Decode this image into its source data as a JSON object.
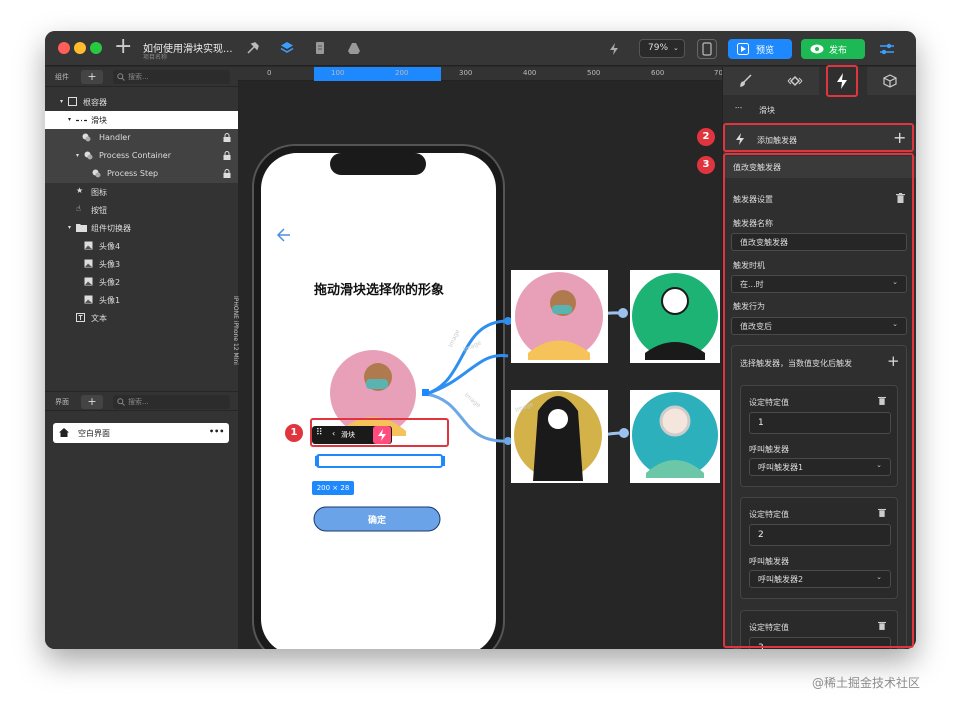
{
  "title": {
    "doc_title": "如何使用滑块实现...",
    "project": "项目名称",
    "zoom": "79%",
    "preview": "预览",
    "publish": "发布"
  },
  "layers": {
    "header": "组件",
    "search_placeholder": "搜索...",
    "items": [
      {
        "label": "根容器",
        "type": "container"
      },
      {
        "label": "滑块",
        "type": "slider",
        "selected": true
      },
      {
        "label": "Handler",
        "type": "group",
        "locked": true
      },
      {
        "label": "Process Container",
        "type": "group",
        "locked": true
      },
      {
        "label": "Process Step",
        "type": "group",
        "locked": true
      },
      {
        "label": "图标",
        "type": "star"
      },
      {
        "label": "按钮",
        "type": "hand"
      },
      {
        "label": "组件切换器",
        "type": "folder"
      },
      {
        "label": "头像4",
        "type": "image"
      },
      {
        "label": "头像3",
        "type": "image"
      },
      {
        "label": "头像2",
        "type": "image"
      },
      {
        "label": "头像1",
        "type": "image"
      },
      {
        "label": "文本",
        "type": "text"
      }
    ]
  },
  "pages": {
    "header": "界面",
    "search_placeholder": "搜索...",
    "item": "空白界面",
    "more": "•••"
  },
  "ruler": {
    "ticks": [
      "0",
      "100",
      "200",
      "300",
      "400",
      "500",
      "600",
      "70"
    ]
  },
  "canvas": {
    "device_label": "IPHONE  iPhone 12 Mini",
    "heading": "拖动滑块选择你的形象",
    "toolbar_label": "滑块",
    "size_label": "200 × 28",
    "confirm": "确定",
    "edge_label": "Image"
  },
  "inspector": {
    "element_name": "滑块",
    "add_trigger": "添加触发器",
    "section": "值改变触发器",
    "settings_title": "触发器设置",
    "name_label": "触发器名称",
    "name_value": "值改变触发器",
    "when_label": "触发时机",
    "when_value": "在...时",
    "action_label": "触发行为",
    "action_value": "值改变后",
    "select_label": "选择触发器，当数值变化后触发",
    "cards": [
      {
        "set_label": "设定特定值",
        "value": "1",
        "call_label": "呼叫触发器",
        "call_value": "呼叫触发器1"
      },
      {
        "set_label": "设定特定值",
        "value": "2",
        "call_label": "呼叫触发器",
        "call_value": "呼叫触发器2"
      },
      {
        "set_label": "设定特定值",
        "value": "3"
      }
    ]
  },
  "annotations": [
    "1",
    "2",
    "3"
  ],
  "watermark": "@稀土掘金技术社区",
  "colors": {
    "accent": "#1e88ff",
    "publish": "#1db954",
    "highlight": "#e0353f",
    "slider_handle": "#ff4d7d"
  }
}
